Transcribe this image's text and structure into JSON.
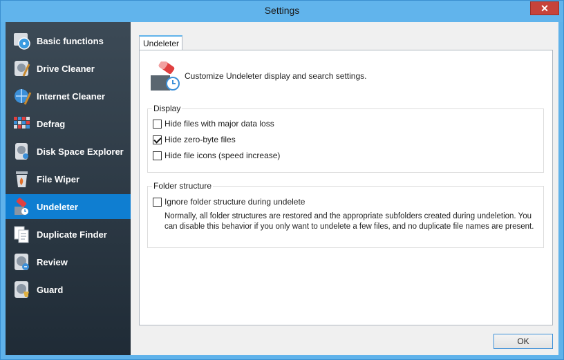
{
  "window": {
    "title": "Settings",
    "close_glyph": "✕"
  },
  "sidebar": {
    "items": [
      {
        "label": "Basic functions",
        "icon": "basic-functions-icon"
      },
      {
        "label": "Drive Cleaner",
        "icon": "drive-cleaner-icon"
      },
      {
        "label": "Internet Cleaner",
        "icon": "internet-cleaner-icon"
      },
      {
        "label": "Defrag",
        "icon": "defrag-icon"
      },
      {
        "label": "Disk Space Explorer",
        "icon": "disk-space-explorer-icon"
      },
      {
        "label": "File Wiper",
        "icon": "file-wiper-icon"
      },
      {
        "label": "Undeleter",
        "icon": "undeleter-icon",
        "active": true
      },
      {
        "label": "Duplicate Finder",
        "icon": "duplicate-finder-icon"
      },
      {
        "label": "Review",
        "icon": "review-icon"
      },
      {
        "label": "Guard",
        "icon": "guard-icon"
      }
    ]
  },
  "tab": {
    "label": "Undeleter"
  },
  "header": {
    "text": "Customize Undeleter display and search settings."
  },
  "display_group": {
    "title": "Display",
    "options": [
      {
        "label": "Hide files with major data loss",
        "checked": false
      },
      {
        "label": "Hide zero-byte files",
        "checked": true
      },
      {
        "label": "Hide file icons (speed increase)",
        "checked": false
      }
    ]
  },
  "folder_group": {
    "title": "Folder structure",
    "option": {
      "label": "Ignore folder structure during undelete",
      "checked": false
    },
    "note": "Normally, all folder structures are restored and the appropriate subfolders created during undeletion. You can disable this behavior if you only want to undelete a few files, and no duplicate file names are present."
  },
  "buttons": {
    "ok": "OK"
  },
  "colors": {
    "accent": "#0f7ed1",
    "titlebar": "#61b4ec",
    "sidebar": "#2b3844"
  }
}
